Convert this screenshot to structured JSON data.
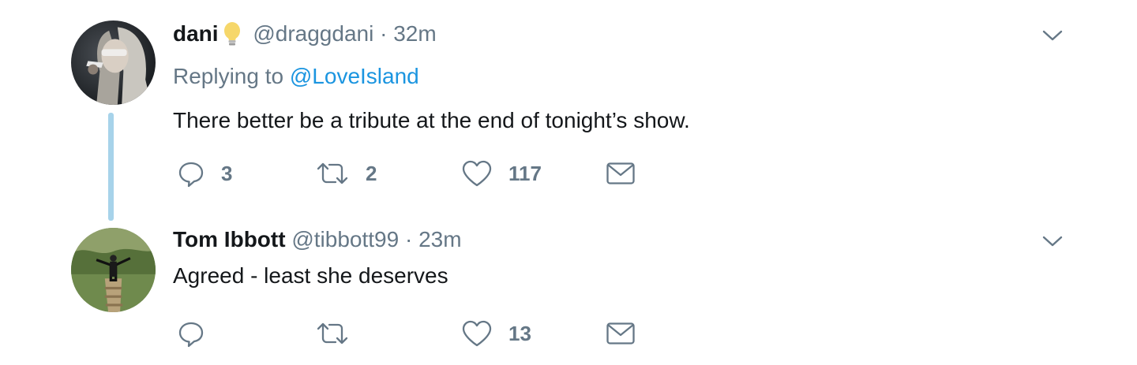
{
  "tweets": [
    {
      "display_name": "dani",
      "emoji_icon": "light-bulb-icon",
      "handle": "@draggdani",
      "separator": "·",
      "timestamp": "32m",
      "replying_prefix": "Replying to",
      "replying_mention": "@LoveIsland",
      "text": "There better be a tribute at the end of tonight’s show.",
      "replies": "3",
      "retweets": "2",
      "likes": "117"
    },
    {
      "display_name": "Tom Ibbott",
      "handle": "@tibbott99",
      "separator": "·",
      "timestamp": "23m",
      "text": "Agreed - least she deserves",
      "replies": "",
      "retweets": "",
      "likes": "13"
    }
  ],
  "colors": {
    "text_primary": "#14171a",
    "text_secondary": "#657786",
    "link": "#1b95e0",
    "thread_line": "#a7d3ea"
  }
}
